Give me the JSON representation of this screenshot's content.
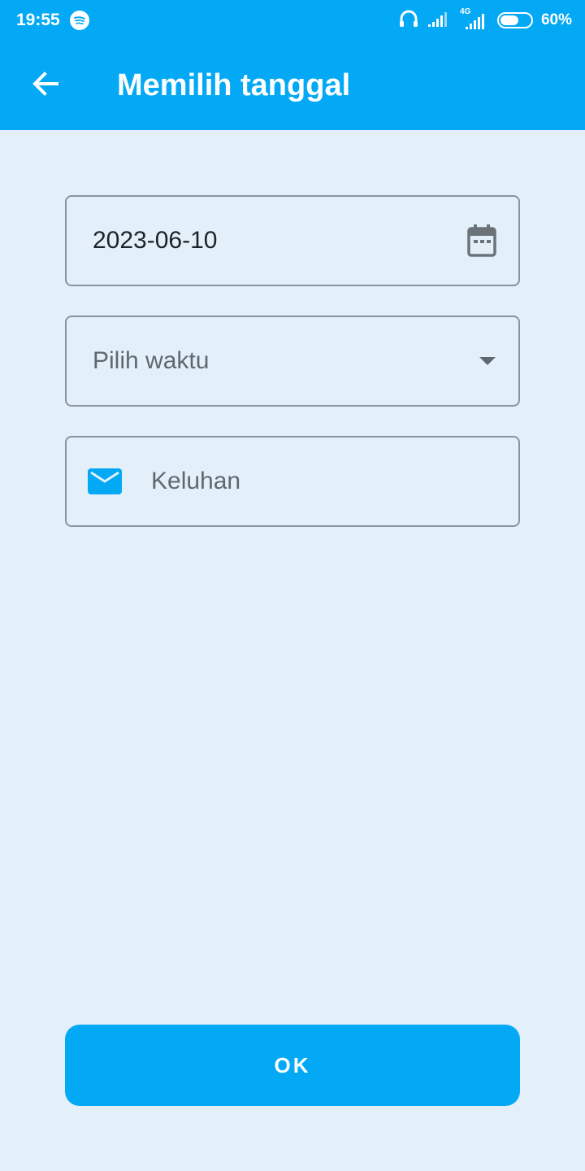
{
  "status_bar": {
    "time": "19:55",
    "battery": "60%",
    "network_label": "4G",
    "icons": [
      "spotify-icon",
      "headphones-icon",
      "signal-icon",
      "battery-icon"
    ]
  },
  "app_bar": {
    "title": "Memilih tanggal",
    "back_icon": "arrow-left-icon"
  },
  "form": {
    "date_value": "2023-06-10",
    "time_placeholder": "Pilih waktu",
    "complaint_placeholder": "Keluhan"
  },
  "actions": {
    "ok_label": "OK"
  },
  "colors": {
    "primary": "#03a9f4",
    "background": "#e3f0fa",
    "field_border": "#8a949c"
  }
}
